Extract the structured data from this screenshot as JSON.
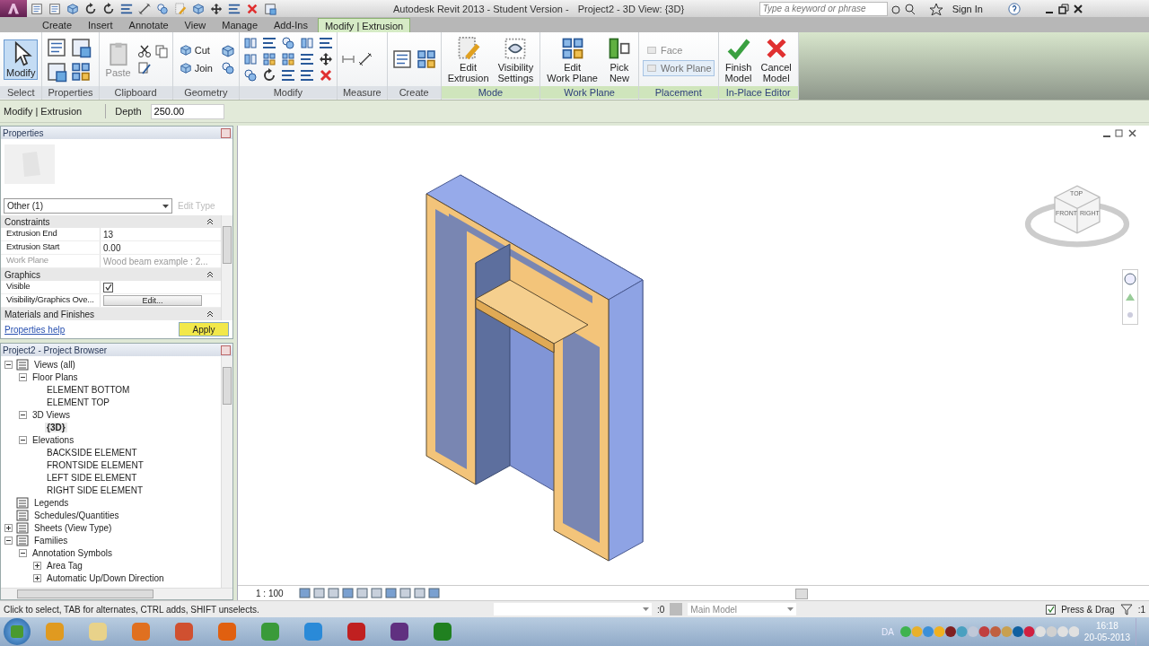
{
  "title_bar": {
    "title": "Autodesk Revit 2013 - Student Version -",
    "document": "Project2 - 3D View: {3D}",
    "search_placeholder": "Type a keyword or phrase",
    "sign_in": "Sign In"
  },
  "tabs": [
    {
      "label": "Create",
      "selected": false
    },
    {
      "label": "Insert",
      "selected": false
    },
    {
      "label": "Annotate",
      "selected": false
    },
    {
      "label": "View",
      "selected": false
    },
    {
      "label": "Manage",
      "selected": false
    },
    {
      "label": "Add-Ins",
      "selected": false
    },
    {
      "label": "Modify | Extrusion",
      "selected": true
    }
  ],
  "ribbon": [
    {
      "label": "Select",
      "contextual": false,
      "buttons": [
        {
          "lines": [
            "Modify"
          ],
          "kind": "large",
          "selected": true,
          "disabled": false
        }
      ]
    },
    {
      "label": "Properties",
      "contextual": false
    },
    {
      "label": "Clipboard",
      "contextual": false,
      "buttons": [
        {
          "lines": [
            "Paste"
          ],
          "kind": "large",
          "selected": false,
          "disabled": true
        }
      ]
    },
    {
      "label": "Geometry",
      "contextual": false,
      "buttons": [
        {
          "lines": [
            "Cut"
          ],
          "kind": "small",
          "selected": false,
          "disabled": false
        },
        {
          "lines": [
            "Join"
          ],
          "kind": "small",
          "selected": false,
          "disabled": false
        }
      ]
    },
    {
      "label": "Modify",
      "contextual": false
    },
    {
      "label": "Measure",
      "contextual": false
    },
    {
      "label": "Create",
      "contextual": false
    },
    {
      "label": "Mode",
      "contextual": true,
      "buttons": [
        {
          "lines": [
            "Edit",
            "Extrusion"
          ],
          "kind": "large",
          "selected": false,
          "disabled": false
        },
        {
          "lines": [
            "Visibility",
            "Settings"
          ],
          "kind": "large",
          "selected": false,
          "disabled": false
        }
      ]
    },
    {
      "label": "Work Plane",
      "contextual": true,
      "buttons": [
        {
          "lines": [
            "Edit",
            "Work Plane"
          ],
          "kind": "large",
          "selected": false,
          "disabled": false
        },
        {
          "lines": [
            "Pick",
            "New"
          ],
          "kind": "large",
          "selected": false,
          "disabled": false
        }
      ]
    },
    {
      "label": "Placement",
      "contextual": true,
      "buttons": [
        {
          "lines": [
            "Face"
          ],
          "kind": "small",
          "selected": false,
          "disabled": true
        },
        {
          "lines": [
            "Work Plane"
          ],
          "kind": "small",
          "selected": true,
          "disabled": true
        }
      ]
    },
    {
      "label": "In-Place Editor",
      "contextual": true,
      "buttons": [
        {
          "lines": [
            "Finish",
            "Model"
          ],
          "kind": "large",
          "selected": false,
          "disabled": false
        },
        {
          "lines": [
            "Cancel",
            "Model"
          ],
          "kind": "large",
          "selected": false,
          "disabled": false
        }
      ]
    }
  ],
  "options_bar": {
    "context": "Modify | Extrusion",
    "depth_label": "Depth",
    "depth_value": "250.00"
  },
  "properties": {
    "title": "Properties",
    "type_selector": "Other (1)",
    "edit_type": {
      "label": "Edit Type",
      "disabled": true
    },
    "groups": [
      {
        "name": "Constraints",
        "rows": [
          {
            "label": "Extrusion End",
            "kind": "text",
            "value": "13",
            "disabled": false
          },
          {
            "label": "Extrusion Start",
            "kind": "text",
            "value": "0.00",
            "disabled": false
          },
          {
            "label": "Work Plane",
            "kind": "text",
            "value": "Wood beam example : 2...",
            "disabled": true
          }
        ]
      },
      {
        "name": "Graphics",
        "rows": [
          {
            "label": "Visible",
            "kind": "checkbox",
            "checked": true,
            "disabled": false
          },
          {
            "label": "Visibility/Graphics Ove...",
            "kind": "button",
            "value": "Edit...",
            "disabled": false
          }
        ]
      },
      {
        "name": "Materials and Finishes"
      }
    ],
    "help_link": "Properties help",
    "apply": "Apply"
  },
  "project_browser": {
    "title": "Project2 - Project Browser",
    "tree": [
      {
        "label": "Views (all)",
        "expanded": true,
        "selected": false,
        "children": [
          {
            "label": "Floor Plans",
            "expanded": true,
            "selected": false,
            "children": [
              {
                "label": "ELEMENT BOTTOM",
                "selected": false
              },
              {
                "label": "ELEMENT TOP",
                "selected": false
              }
            ]
          },
          {
            "label": "3D Views",
            "expanded": true,
            "selected": false,
            "children": [
              {
                "label": "{3D}",
                "selected": true
              }
            ]
          },
          {
            "label": "Elevations",
            "expanded": true,
            "selected": false,
            "children": [
              {
                "label": "BACKSIDE ELEMENT",
                "selected": false
              },
              {
                "label": "FRONTSIDE ELEMENT",
                "selected": false
              },
              {
                "label": "LEFT SIDE ELEMENT",
                "selected": false
              },
              {
                "label": "RIGHT SIDE ELEMENT",
                "selected": false
              }
            ]
          }
        ]
      },
      {
        "label": "Legends",
        "selected": false
      },
      {
        "label": "Schedules/Quantities",
        "selected": false
      },
      {
        "label": "Sheets (View Type)",
        "expanded": false,
        "selected": false
      },
      {
        "label": "Families",
        "expanded": true,
        "selected": false,
        "children": [
          {
            "label": "Annotation Symbols",
            "expanded": true,
            "selected": false,
            "children": [
              {
                "label": "Area Tag",
                "expanded": false,
                "selected": false
              },
              {
                "label": "Automatic Up/Down Direction",
                "expanded": false,
                "selected": false
              }
            ]
          }
        ]
      }
    ]
  },
  "view": {
    "scale": "1 : 100",
    "view_cube": [
      "TOP",
      "FRONT",
      "RIGHT"
    ]
  },
  "status_bar": {
    "hint": "Click to select, TAB for alternates, CTRL adds, SHIFT unselects.",
    "editable_count": ":0",
    "model": "Main Model",
    "press_drag": {
      "label": "Press & Drag",
      "checked": true
    },
    "selection_count": ":1"
  },
  "taskbar": {
    "language": "DA",
    "time": "16:18",
    "date": "20-05-2013"
  }
}
